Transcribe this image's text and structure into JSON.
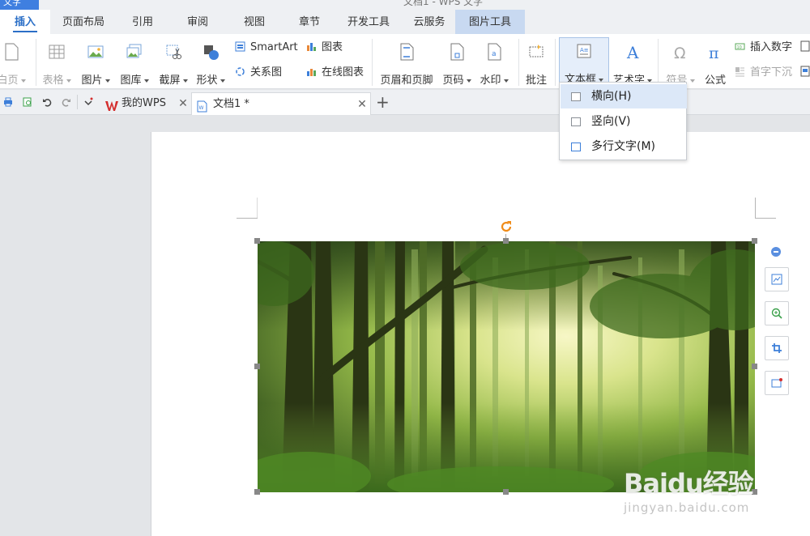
{
  "window": {
    "app_menu_label": "文字",
    "doc_title": "文档1 - WPS 文字"
  },
  "ribbon_tabs": [
    {
      "label": "插入",
      "state": "active"
    },
    {
      "label": "页面布局"
    },
    {
      "label": "引用"
    },
    {
      "label": "审阅"
    },
    {
      "label": "视图"
    },
    {
      "label": "章节"
    },
    {
      "label": "开发工具"
    },
    {
      "label": "云服务"
    },
    {
      "label": "图片工具",
      "state": "contextual"
    }
  ],
  "ribbon": {
    "blank_page": "白页",
    "table": "表格",
    "picture": "图片",
    "gallery": "图库",
    "screenshot": "截屏",
    "shapes": "形状",
    "smartart": "SmartArt",
    "chart": "图表",
    "relation_chart": "关系图",
    "online_chart": "在线图表",
    "header_footer": "页眉和页脚",
    "page_number": "页码",
    "watermark": "水印",
    "comment": "批注",
    "textbox": "文本框",
    "wordart": "艺术字",
    "symbol": "符号",
    "formula": "公式",
    "insert_number": "插入数字",
    "drop_cap": "首字下沉"
  },
  "doc_tabs": [
    {
      "label": "我的WPS"
    },
    {
      "label": "文档1 *",
      "state": "active"
    }
  ],
  "textbox_menu": {
    "items": [
      {
        "label": "横向(H)",
        "state": "hover"
      },
      {
        "label": "竖向(V)"
      },
      {
        "label": "多行文字(M)"
      }
    ]
  },
  "watermark": {
    "logo": "Baidu经验",
    "url": "jingyan.baidu.com"
  },
  "colors": {
    "accent": "#2b6fc7",
    "wps_red": "#d42e2e",
    "contextual_tab": "#c8d9f1",
    "menu_highlight": "#dce8f8"
  }
}
